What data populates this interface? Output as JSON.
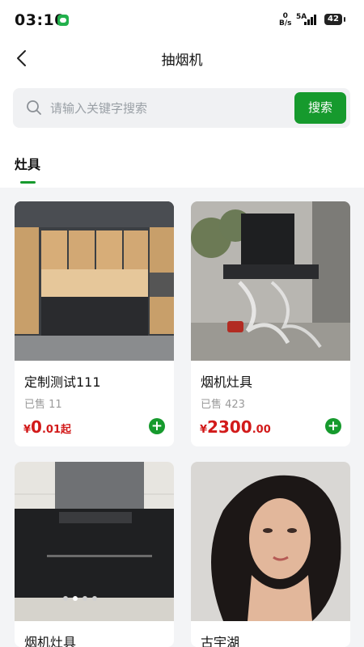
{
  "status": {
    "time": "03:10",
    "net_speed": "0",
    "net_unit": "B/s",
    "signal": "5A",
    "battery": "42"
  },
  "nav": {
    "title": "抽烟机"
  },
  "search": {
    "placeholder": "请输入关键字搜索",
    "button": "搜索"
  },
  "tabs": [
    {
      "label": "灶具",
      "active": true
    }
  ],
  "products": [
    {
      "name": "定制测试111",
      "sold": "已售 11",
      "currency": "¥",
      "price_int": "0",
      "price_dec": ".01起"
    },
    {
      "name": "烟机灶具",
      "sold": "已售 423",
      "currency": "¥",
      "price_int": "2300",
      "price_dec": ".00"
    },
    {
      "name": "烟机灶具"
    },
    {
      "name": "古宇湖"
    }
  ],
  "colors": {
    "accent": "#169a2d",
    "price": "#d21a1a",
    "background": "#f3f4f6"
  }
}
